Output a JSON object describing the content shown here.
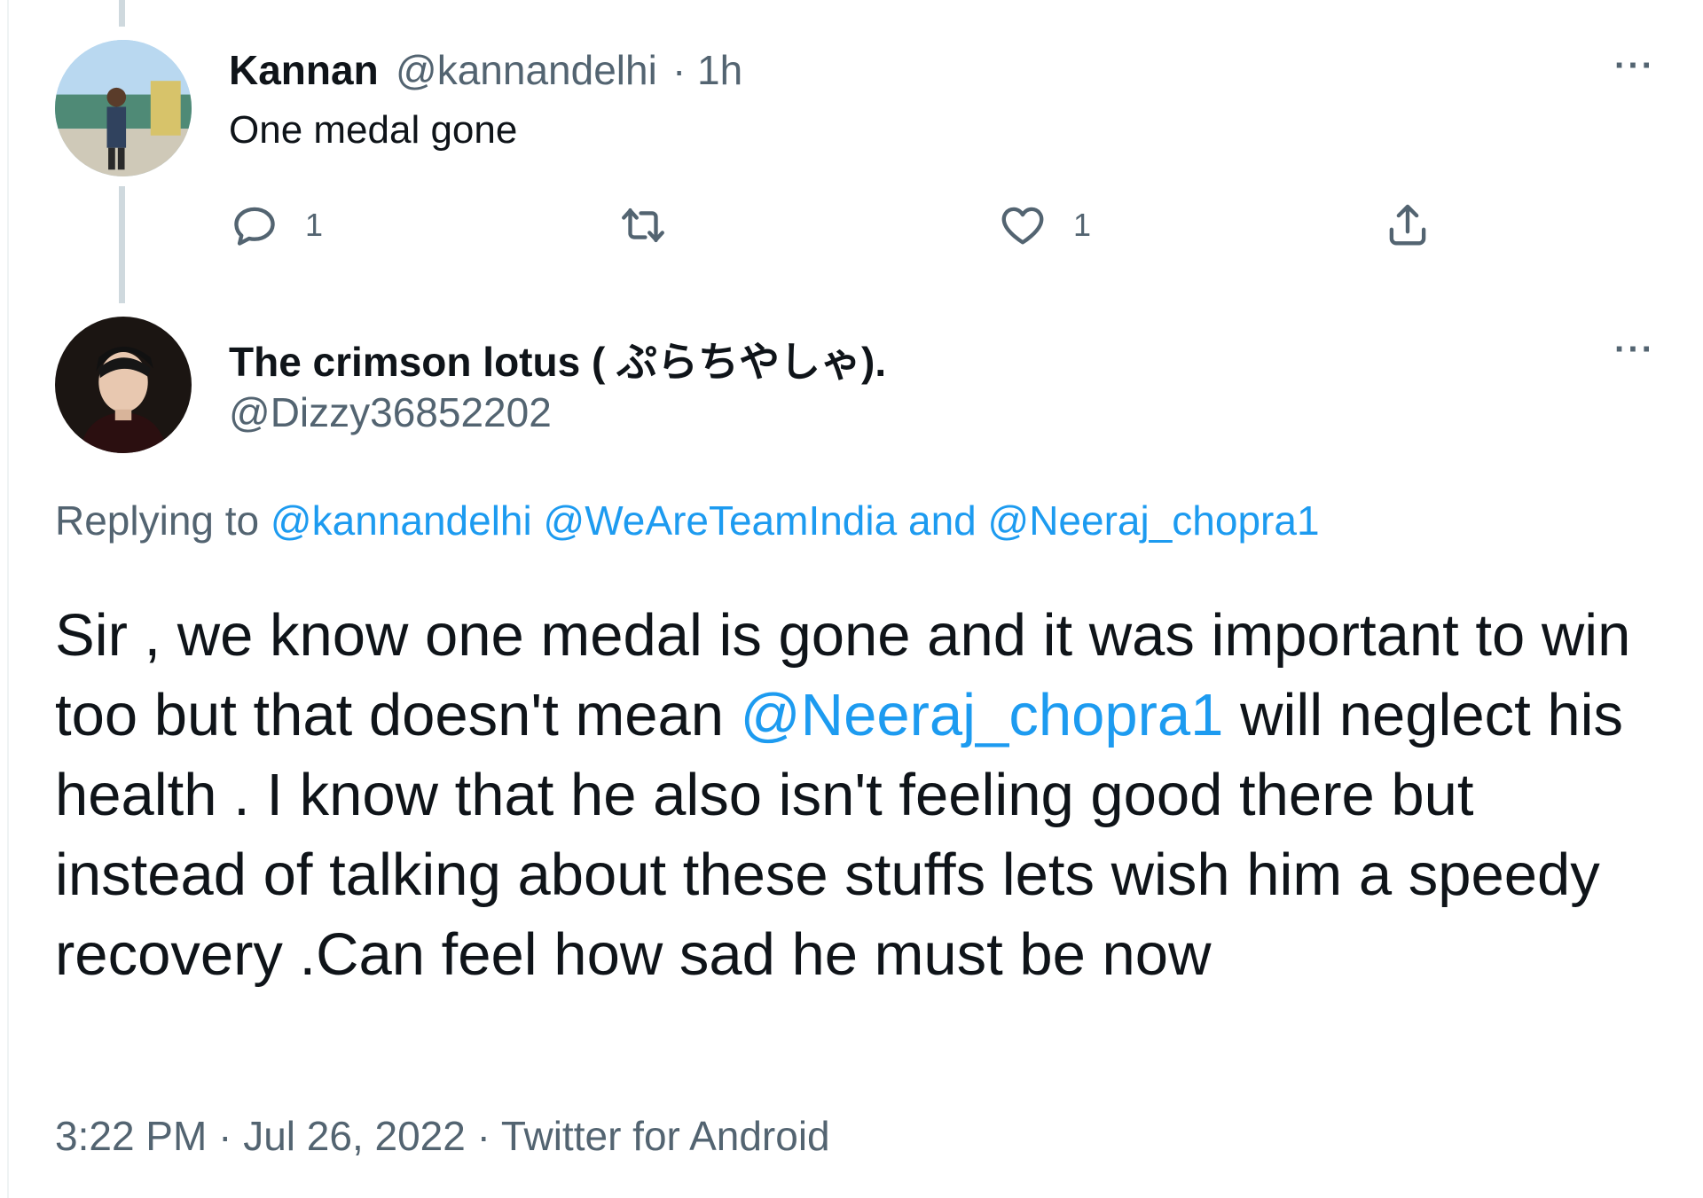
{
  "parent_tweet": {
    "display_name": "Kannan",
    "handle": "@kannandelhi",
    "separator": "·",
    "time": "1h",
    "text": "One medal gone",
    "more_label": "···",
    "actions": {
      "reply_count": "1",
      "retweet_count": "",
      "like_count": "1"
    }
  },
  "reply_tweet": {
    "display_name": "The crimson lotus ( ぷらちやしゃ).",
    "handle": "@Dizzy36852202",
    "more_label": "···",
    "replying_to_prefix": "Replying to",
    "replying_to_users": [
      "@kannandelhi",
      "@WeAreTeamIndia"
    ],
    "replying_to_and": "and",
    "replying_to_last": "@Neeraj_chopra1",
    "text_part1": "Sir , we know one medal is gone and it was important to win too but that doesn't mean ",
    "mention": "@Neeraj_chopra1",
    "text_part2": " will neglect his health . I know that he also isn't feeling good there but instead of talking about these stuffs lets wish him a speedy recovery .Can feel how sad he must be now",
    "time": "3:22 PM",
    "separator": "·",
    "date": "Jul 26, 2022",
    "client": "Twitter for Android"
  },
  "colors": {
    "text_primary": "#0f1419",
    "text_secondary": "#536471",
    "link": "#1d9bf0",
    "thread_line": "#cfd9de"
  },
  "icons": [
    "reply-icon",
    "retweet-icon",
    "like-icon",
    "share-icon",
    "more-icon"
  ]
}
